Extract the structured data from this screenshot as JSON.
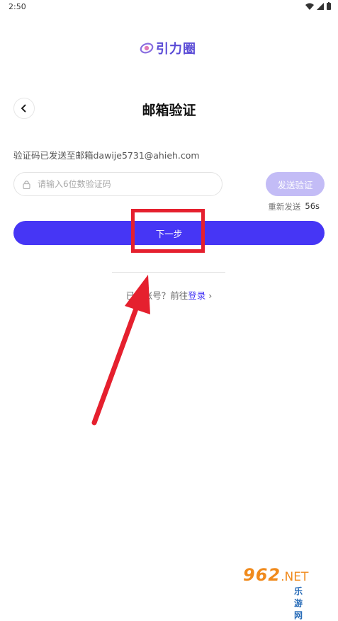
{
  "status_bar": {
    "time": "2:50"
  },
  "logo": {
    "text": "引力圈"
  },
  "header": {
    "title": "邮箱验证"
  },
  "info": {
    "text": "验证码已发送至邮箱dawije5731@ahieh.com"
  },
  "code_input": {
    "placeholder": "请输入6位数验证码",
    "value": ""
  },
  "send_button": {
    "label": "发送验证"
  },
  "resend": {
    "label": "重新发送",
    "countdown": "56s"
  },
  "next_button": {
    "label": "下一步"
  },
  "login_row": {
    "prefix": "已有账号？前往",
    "link": "登录",
    "chevron": "›"
  },
  "watermark": {
    "main": "962",
    "net": ".NET",
    "sub": "乐游网"
  },
  "colors": {
    "primary": "#4636f5",
    "disabled": "#c3bcf6",
    "annotation": "#e5202e",
    "logo": "#5a4bd6"
  }
}
